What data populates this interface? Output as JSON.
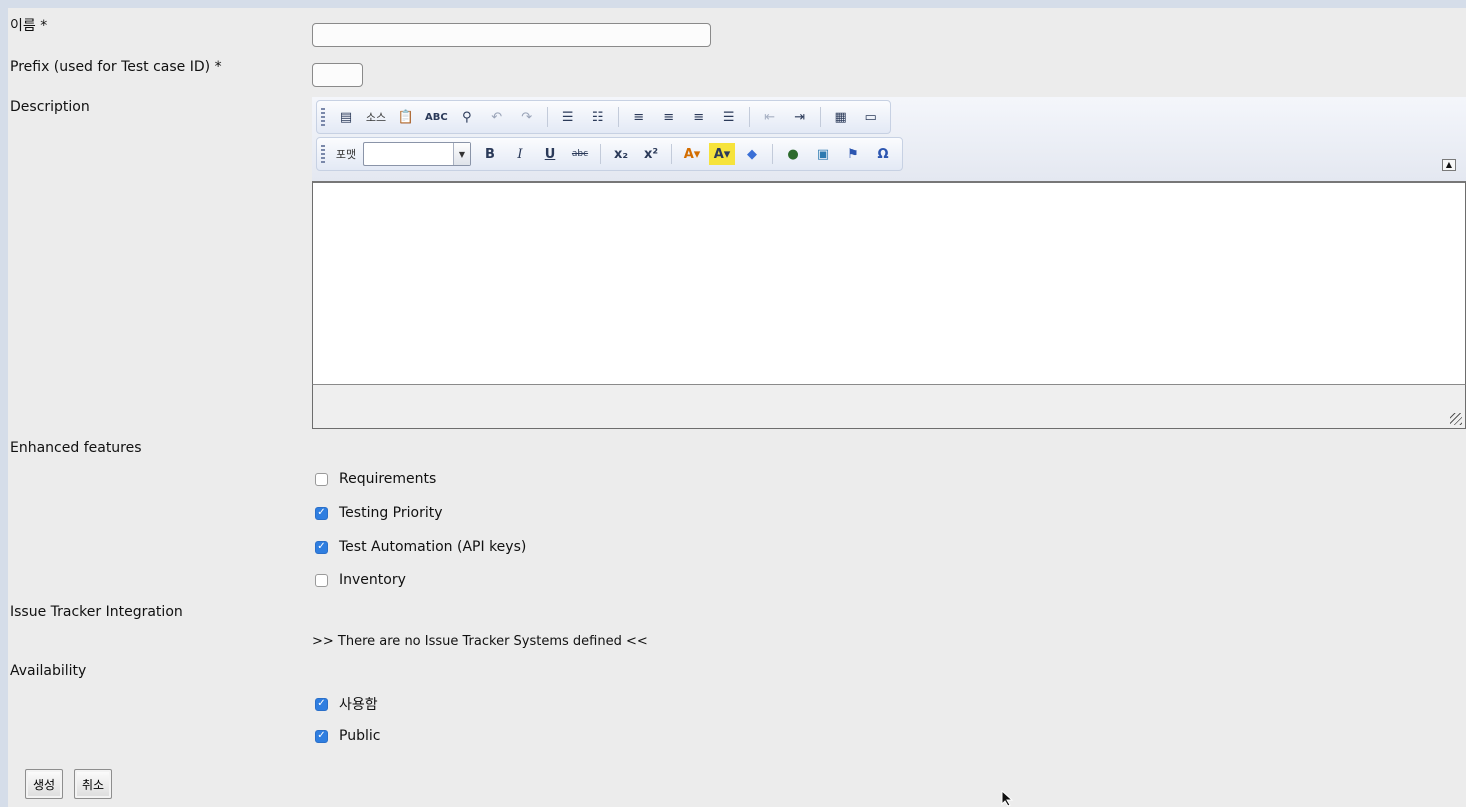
{
  "form": {
    "name_label": "이름 *",
    "name_value": "",
    "prefix_label": "Prefix (used for Test case ID) *",
    "prefix_value": "",
    "description_label": "Description",
    "enhanced_label": "Enhanced features",
    "issue_tracker_label": "Issue Tracker Integration",
    "issue_tracker_notice": ">> There are no Issue Tracker Systems defined <<",
    "availability_label": "Availability"
  },
  "editor": {
    "source_label": "소스",
    "format_label": "포맷",
    "format_value": "",
    "toolbar_row1": [
      "page-icon",
      "source-button",
      "paste-text-icon",
      "spellcheck-icon",
      "find-icon",
      "undo-icon",
      "redo-icon",
      "numbered-list-icon",
      "bulleted-list-icon",
      "align-left-icon",
      "align-center-icon",
      "align-right-icon",
      "justify-icon",
      "outdent-icon",
      "indent-icon",
      "table-icon",
      "horizontal-rule-icon"
    ],
    "toolbar_row2": [
      "bold-icon",
      "italic-icon",
      "underline-icon",
      "strike-icon",
      "subscript-icon",
      "superscript-icon",
      "text-color-icon",
      "bg-color-icon",
      "remove-format-icon",
      "link-icon",
      "image-icon",
      "anchor-icon",
      "special-char-icon"
    ],
    "content": ""
  },
  "features": [
    {
      "label": "Requirements",
      "checked": false
    },
    {
      "label": "Testing Priority",
      "checked": true
    },
    {
      "label": "Test Automation (API keys)",
      "checked": true
    },
    {
      "label": "Inventory",
      "checked": false
    }
  ],
  "availability": [
    {
      "label": "사용함",
      "checked": true
    },
    {
      "label": "Public",
      "checked": true
    }
  ],
  "buttons": {
    "create_label": "생성",
    "cancel_label": "취소"
  },
  "colors": {
    "page_bg": "#ececec",
    "frame_bg": "#d5dde9",
    "checkbox_checked": "#2f7ee0"
  }
}
